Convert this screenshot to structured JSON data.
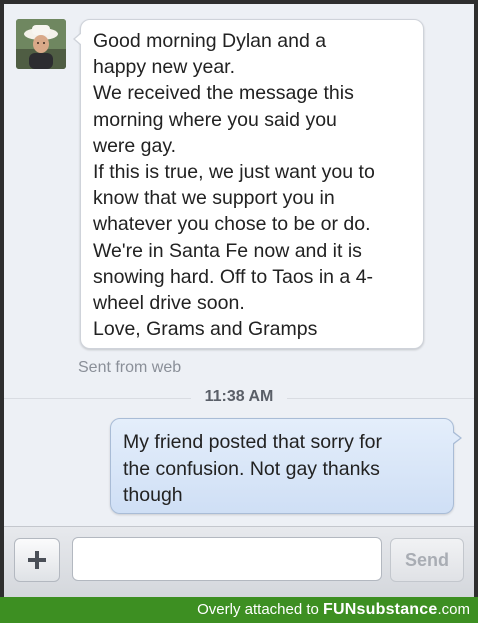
{
  "conversation": {
    "incoming": {
      "lines": [
        "Good morning Dylan and a",
        "happy new year.",
        "We received the message this",
        "morning where you said you",
        "were gay.",
        "If this is true, we just want you to",
        "know that we support you in",
        "whatever you chose to be or do.",
        "We're in Santa Fe now and it is",
        "snowing hard. Off to Taos in a 4-",
        "wheel drive soon.",
        "Love, Grams and Gramps"
      ],
      "sent_from": "Sent from web"
    },
    "timestamp": "11:38 AM",
    "outgoing": {
      "lines": [
        "My friend posted that sorry for",
        "the confusion. Not gay thanks",
        "though"
      ]
    }
  },
  "composer": {
    "input_value": "",
    "send_label": "Send",
    "add_icon": "plus-icon"
  },
  "footer": {
    "prefix": "Overly attached to ",
    "brand": "FUNsubstance",
    "suffix": ".com"
  },
  "colors": {
    "footer_bg": "#3d8f22",
    "outgoing_bubble": "#dbe7f8",
    "incoming_bubble": "#ffffff"
  }
}
